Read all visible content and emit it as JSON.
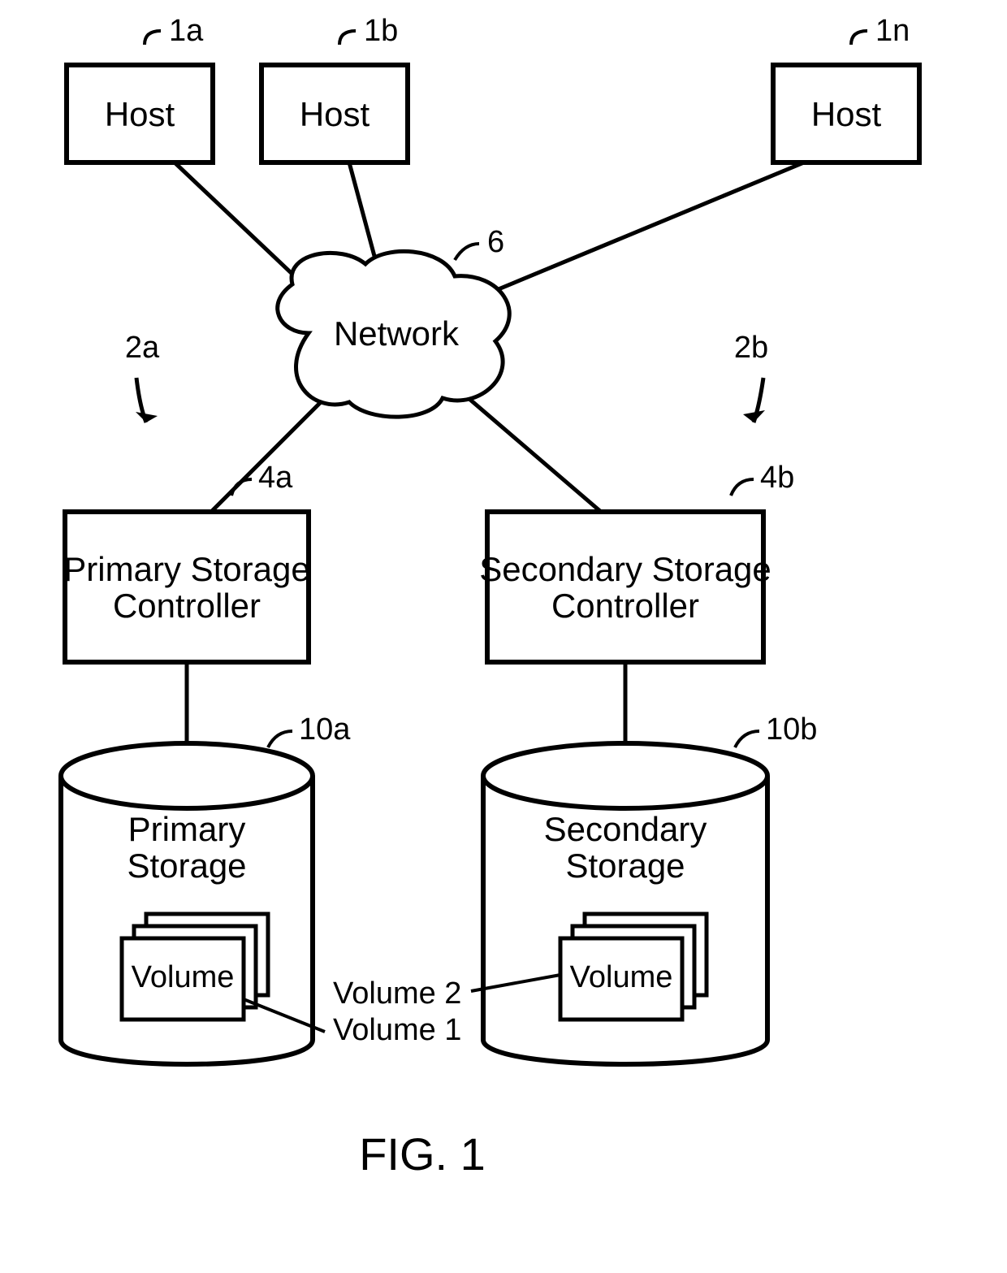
{
  "figure_caption": "FIG. 1",
  "hosts": {
    "a": {
      "ref": "1a",
      "label": "Host"
    },
    "b": {
      "ref": "1b",
      "label": "Host"
    },
    "n": {
      "ref": "1n",
      "label": "Host"
    }
  },
  "sites": {
    "left_ref": "2a",
    "right_ref": "2b"
  },
  "network": {
    "ref": "6",
    "label": "Network"
  },
  "controllers": {
    "primary": {
      "ref": "4a",
      "line1": "Primary Storage",
      "line2": "Controller"
    },
    "secondary": {
      "ref": "4b",
      "line1": "Secondary Storage",
      "line2": "Controller"
    }
  },
  "storages": {
    "primary": {
      "ref": "10a",
      "line1": "Primary",
      "line2": "Storage",
      "volume": "Volume",
      "vol_ref": "Volume 1"
    },
    "secondary": {
      "ref": "10b",
      "line1": "Secondary",
      "line2": "Storage",
      "volume": "Volume",
      "vol_ref": "Volume 2"
    }
  }
}
